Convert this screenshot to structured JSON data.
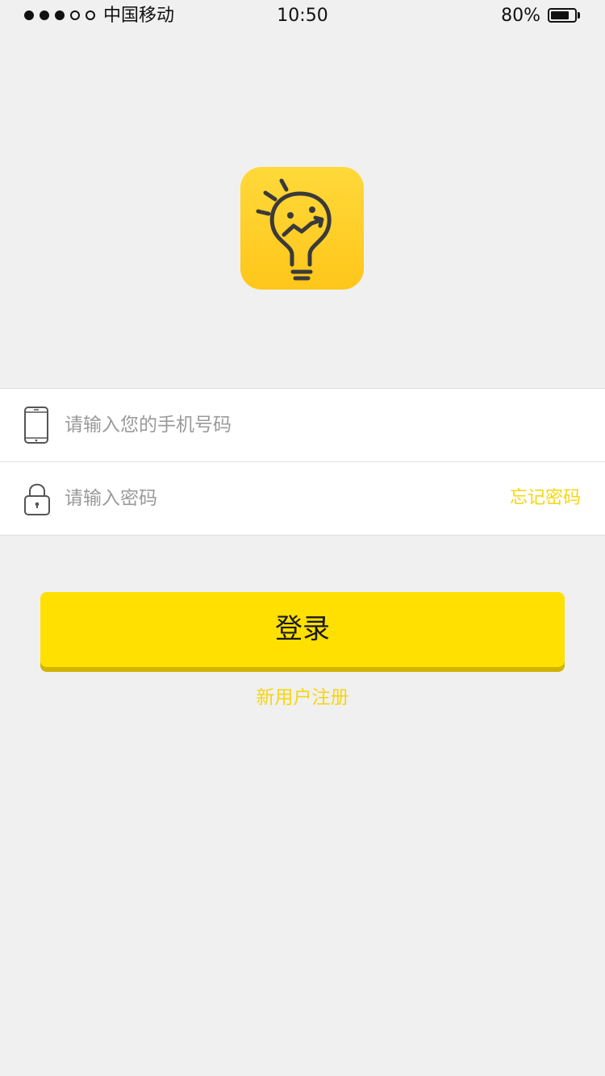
{
  "status_bar": {
    "signal_bars": [
      true,
      true,
      true,
      false,
      false
    ],
    "carrier": "中国移动",
    "time": "10:50",
    "battery_percent_label": "80%",
    "battery_level": 0.8
  },
  "logo": {
    "icon": "lightbulb-chart-icon",
    "background_color": "#ffcc22"
  },
  "form": {
    "phone": {
      "icon": "phone-icon",
      "placeholder": "请输入您的手机号码",
      "value": ""
    },
    "password": {
      "icon": "lock-icon",
      "placeholder": "请输入密码",
      "value": "",
      "forgot_label": "忘记密码"
    }
  },
  "actions": {
    "login_label": "登录",
    "register_label": "新用户注册"
  },
  "colors": {
    "accent": "#ffe000",
    "link": "#f7d510",
    "background": "#f0f0f0"
  }
}
